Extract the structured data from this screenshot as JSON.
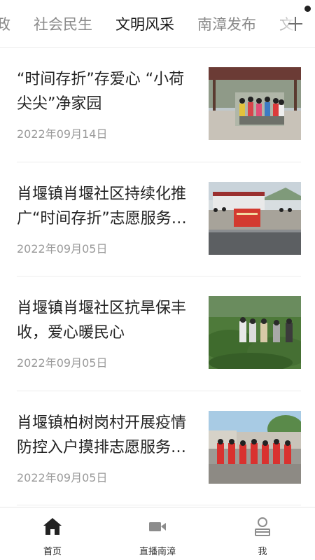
{
  "tabs": [
    {
      "label": "政",
      "active": false
    },
    {
      "label": "社会民生",
      "active": false
    },
    {
      "label": "文明风采",
      "active": true
    },
    {
      "label": "南漳发布",
      "active": false
    },
    {
      "label": "文",
      "active": false
    }
  ],
  "news": [
    {
      "title": "“时间存折”存爱心 “小荷尖尖”净家园",
      "date": "2022年09月14日",
      "image": "playground-volunteers-photo"
    },
    {
      "title": "肖堰镇肖堰社区持续化推广“时间存折”志愿服务…",
      "date": "2022年09月05日",
      "image": "community-banner-group-photo"
    },
    {
      "title": "肖堰镇肖堰社区抗旱保丰收，爱心暖民心",
      "date": "2022年09月05日",
      "image": "tea-field-watering-photo"
    },
    {
      "title": "肖堰镇柏树岗村开展疫情防控入户摸排志愿服务…",
      "date": "2022年09月05日",
      "image": "red-vest-volunteers-photo"
    }
  ],
  "bottom_nav": [
    {
      "label": "首页",
      "icon": "home-icon",
      "active": true
    },
    {
      "label": "直播南漳",
      "icon": "video-camera-icon",
      "active": false
    },
    {
      "label": "我",
      "icon": "user-icon",
      "active": false
    }
  ]
}
